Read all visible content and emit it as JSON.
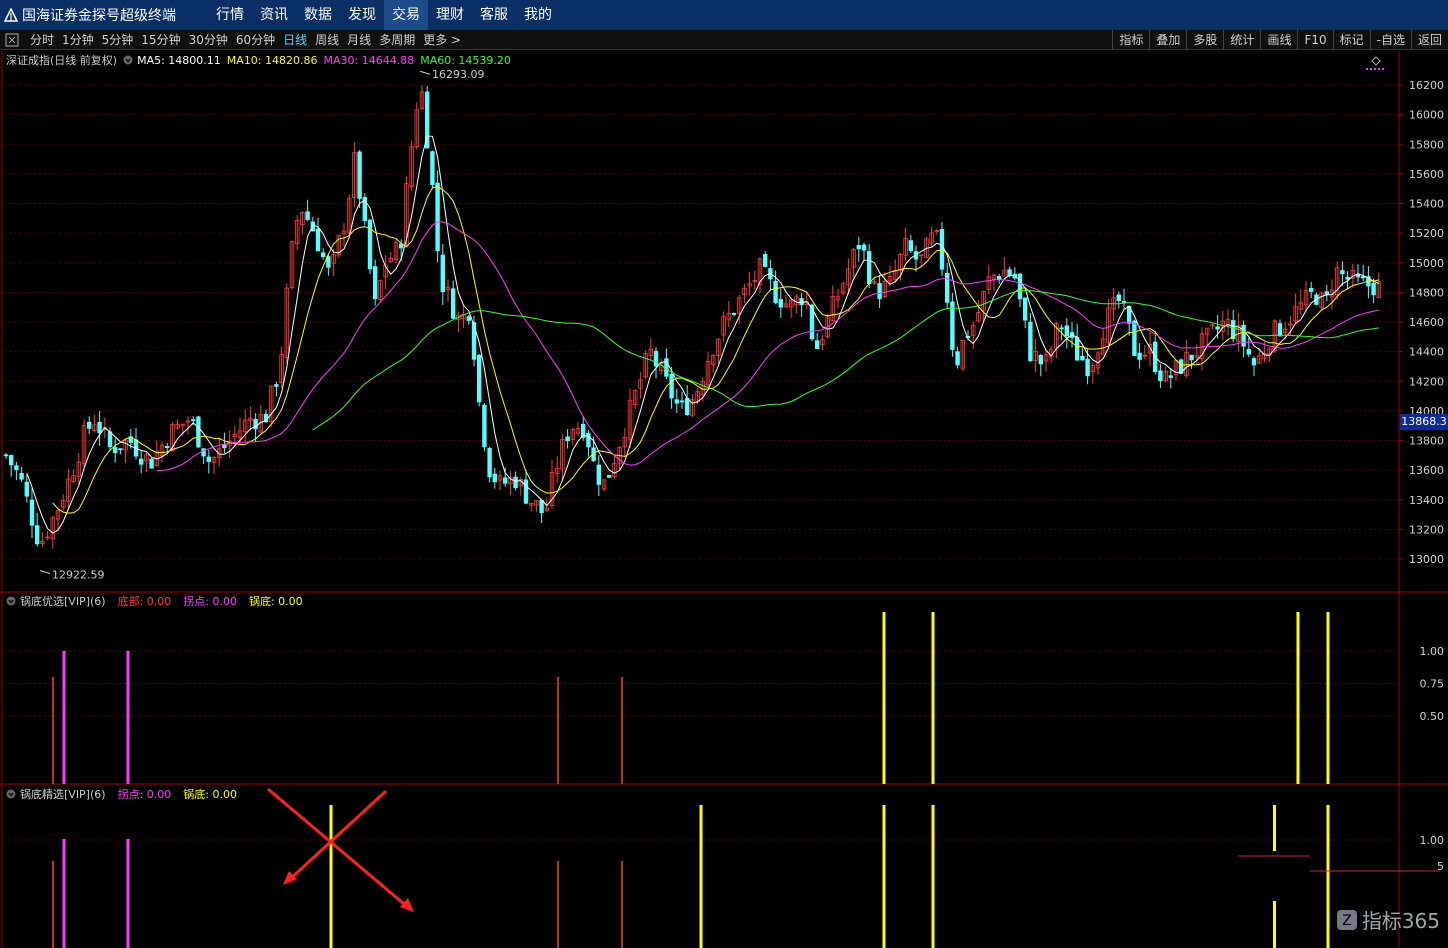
{
  "app": {
    "title": "国海证券金探号超级终端",
    "nav": [
      "行情",
      "资讯",
      "数据",
      "发现",
      "交易",
      "理财",
      "客服",
      "我的"
    ],
    "active_nav": "交易"
  },
  "toolbar": {
    "periods": [
      "分时",
      "1分钟",
      "5分钟",
      "15分钟",
      "30分钟",
      "60分钟",
      "日线",
      "周线",
      "月线",
      "多周期",
      "更多 >"
    ],
    "active_period": "日线",
    "right_buttons": [
      "指标",
      "叠加",
      "多股",
      "统计",
      "画线",
      "F10",
      "标记",
      "-自选",
      "返回"
    ]
  },
  "main_panel": {
    "title": "深证成指(日线 前复权)",
    "ma": [
      {
        "label": "MA5: 14800.11",
        "color": "#ffffff"
      },
      {
        "label": "MA10: 14820.86",
        "color": "#ffff00"
      },
      {
        "label": "MA30: 14644.88",
        "color": "#ff3cff"
      },
      {
        "label": "MA60: 14539.20",
        "color": "#33ff33"
      }
    ],
    "high_label": "16293.09",
    "low_label": "12922.59",
    "current_price": "13868.3",
    "y_ticks": [
      "16200",
      "16000",
      "15800",
      "15600",
      "15400",
      "15200",
      "15000",
      "14800",
      "14600",
      "14400",
      "14200",
      "14000",
      "13800",
      "13600",
      "13400",
      "13200",
      "13000"
    ]
  },
  "panel1": {
    "title": "锅底优选[VIP](6)",
    "items": [
      {
        "label": "底部: 0.00",
        "color": "#ff3b3b"
      },
      {
        "label": "拐点: 0.00",
        "color": "#ff3cff"
      },
      {
        "label": "锅底: 0.00",
        "color": "#ffff00"
      }
    ],
    "y_ticks": [
      "1.00",
      "0.75",
      "0.50"
    ]
  },
  "panel2": {
    "title": "锅底精选[VIP](6)",
    "items": [
      {
        "label": "拐点: 0.00",
        "color": "#ff3cff"
      },
      {
        "label": "锅底: 0.00",
        "color": "#ffff00"
      }
    ],
    "y_ticks": [
      "1.00",
      "5"
    ]
  },
  "watermark": "指标365",
  "colors": {
    "up": "#ff3b3b",
    "down": "#54ffff",
    "grid": "#5a0000",
    "axis": "#a00000",
    "topbar": "#0a2f66"
  }
}
